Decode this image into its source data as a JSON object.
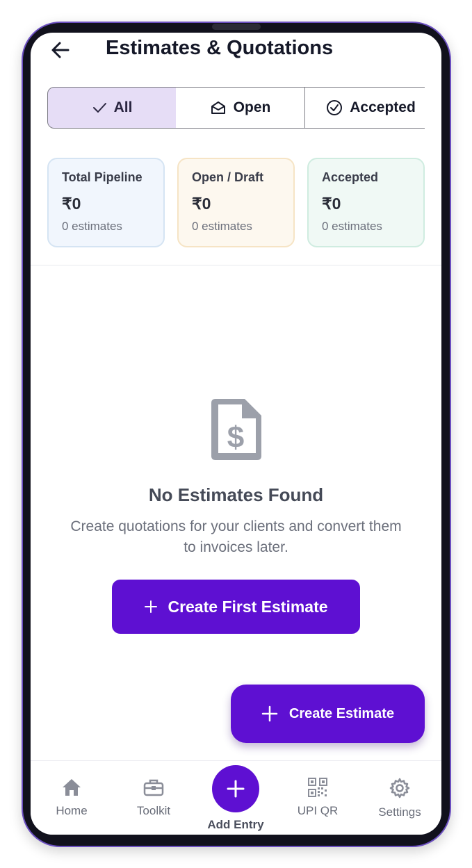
{
  "header": {
    "title": "Estimates & Quotations",
    "back_icon": "arrow-left-icon"
  },
  "tabs": [
    {
      "label": "All",
      "icon": "check-icon",
      "selected": true
    },
    {
      "label": "Open",
      "icon": "envelope-open-icon",
      "selected": false
    },
    {
      "label": "Accepted",
      "icon": "check-circle-icon",
      "selected": false
    }
  ],
  "summary": [
    {
      "label": "Total Pipeline",
      "amount": "₹0",
      "count": "0 estimates",
      "bg": "#f1f6fd",
      "border": "#d5e4f3"
    },
    {
      "label": "Open / Draft",
      "amount": "₹0",
      "count": "0 estimates",
      "bg": "#fdf8ef",
      "border": "#f6e4c5"
    },
    {
      "label": "Accepted",
      "amount": "₹0",
      "count": "0 estimates",
      "bg": "#f0f9f5",
      "border": "#cfece0"
    }
  ],
  "empty_state": {
    "icon": "document-dollar-icon",
    "title": "No Estimates Found",
    "description_line1": "Create quotations for your clients and convert them",
    "description_line2": "to invoices later.",
    "button_label": "Create First Estimate"
  },
  "fab": {
    "label": "Create Estimate",
    "icon": "plus-icon"
  },
  "bottom_nav": {
    "home": "Home",
    "toolkit": "Toolkit",
    "add_entry": "Add Entry",
    "upi_qr": "UPI QR",
    "settings": "Settings"
  },
  "colors": {
    "accent": "#5e10d2",
    "selected_tab": "#e6ddf6"
  }
}
